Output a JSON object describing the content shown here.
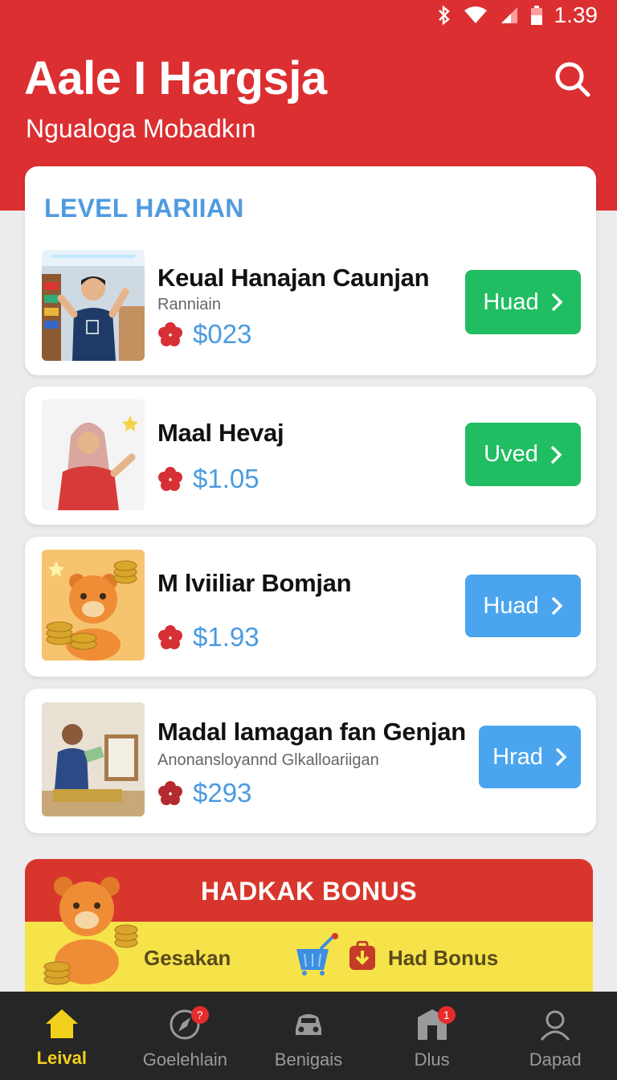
{
  "status_bar": {
    "time": "1.39",
    "icons": [
      "bluetooth-icon",
      "wifi-icon",
      "signal-icon",
      "battery-icon"
    ]
  },
  "header": {
    "title": "Aale I Hargsja",
    "subtitle": "Ngualoga Mobadkın",
    "search_icon": "search-icon",
    "bg_color": "#dc2f31"
  },
  "level_section": {
    "title": "LEVEL HARIIAN",
    "items": [
      {
        "name": "Keual Hanajan Caunjan",
        "subtitle": "Ranniain",
        "price": "$023",
        "button": "Huad",
        "button_color": "green",
        "thumb": "boy-waving-photo"
      },
      {
        "name": "Maal Hevaj",
        "subtitle": "",
        "price": "$1.05",
        "button": "Uved",
        "button_color": "green",
        "thumb": "girl-hijab-photo"
      },
      {
        "name": "M lviiliar Bomjan",
        "subtitle": "",
        "price": "$1.93",
        "button": "Huad",
        "button_color": "blue",
        "thumb": "bear-coins-illustration"
      },
      {
        "name": "Madal lamagan fan Genjan",
        "subtitle": "Anonansloyannd Glkalloariigan",
        "price": "$293",
        "button": "Hrad",
        "button_color": "blue",
        "thumb": "boy-money-photo"
      }
    ]
  },
  "bonus": {
    "title": "HADKAK BONUS",
    "label_left": "Gesakan",
    "label_right": "Had Bonus"
  },
  "bottom_nav": [
    {
      "label": "Leival",
      "icon": "home-icon",
      "active": true,
      "badge": ""
    },
    {
      "label": "Goelehlain",
      "icon": "compass-icon",
      "active": false,
      "badge": "?"
    },
    {
      "label": "Benigais",
      "icon": "car-icon",
      "active": false,
      "badge": ""
    },
    {
      "label": "Dlus",
      "icon": "store-icon",
      "active": false,
      "badge": "1"
    },
    {
      "label": "Dapad",
      "icon": "profile-icon",
      "active": false,
      "badge": ""
    }
  ],
  "colors": {
    "accent_blue": "#4a9be0",
    "green": "#21bd63",
    "blue_button": "#4aa5ee",
    "nav_active": "#f2d11c",
    "bonus_yellow": "#f6e34a"
  }
}
